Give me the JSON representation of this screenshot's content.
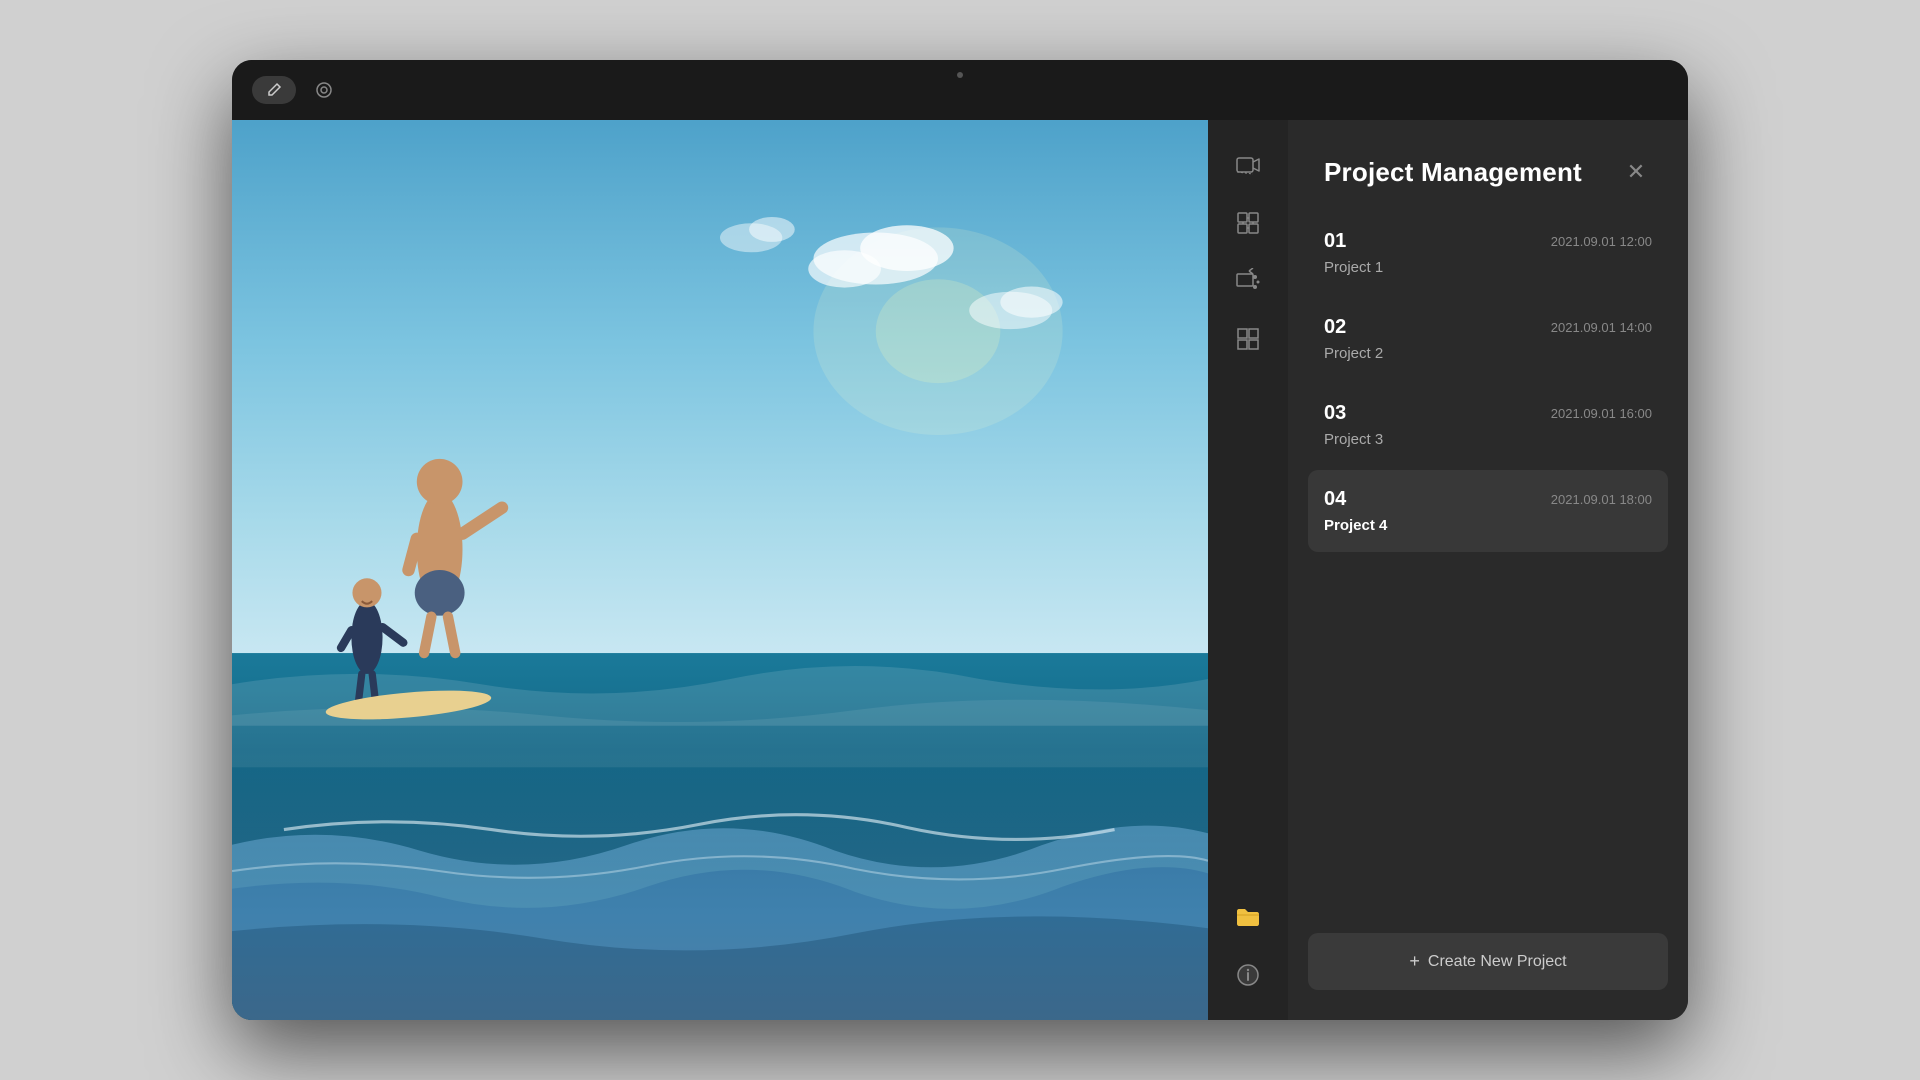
{
  "topBar": {
    "editButtonLabel": "✎",
    "viewButtonLabel": "◎"
  },
  "sidebar": {
    "icons": [
      {
        "name": "video-icon",
        "symbol": "🎬",
        "active": false
      },
      {
        "name": "plugin-icon",
        "symbol": "🧩",
        "active": false
      },
      {
        "name": "effects-icon",
        "symbol": "✨",
        "active": false
      },
      {
        "name": "logo-icon",
        "symbol": "⊞",
        "active": false
      },
      {
        "name": "folder-icon",
        "symbol": "📁",
        "active": true
      },
      {
        "name": "info-icon",
        "symbol": "ℹ",
        "active": false
      }
    ]
  },
  "panel": {
    "title": "Project Management",
    "closeLabel": "✕",
    "projects": [
      {
        "number": "01",
        "name": "Project 1",
        "date": "2021.09.01 12:00",
        "selected": false
      },
      {
        "number": "02",
        "name": "Project 2",
        "date": "2021.09.01 14:00",
        "selected": false
      },
      {
        "number": "03",
        "name": "Project 3",
        "date": "2021.09.01 16:00",
        "selected": false
      },
      {
        "number": "04",
        "name": "Project 4",
        "date": "2021.09.01 18:00",
        "selected": true
      }
    ],
    "createButtonLabel": "Create New Project"
  }
}
